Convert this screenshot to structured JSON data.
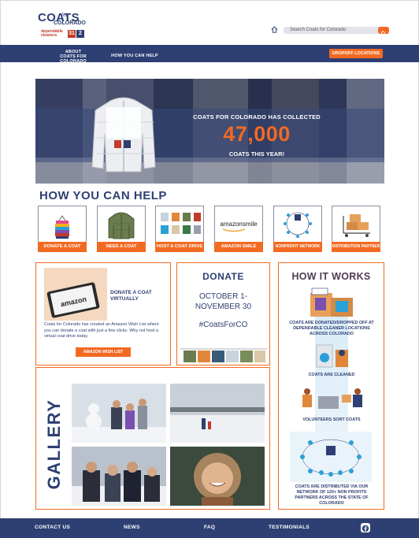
{
  "colors": {
    "navy": "#2e3f73",
    "orange": "#f26a22",
    "plum": "#4e3b52",
    "white": "#ffffff"
  },
  "header": {
    "logo": {
      "line1": "COATS",
      "for": "for",
      "line2": "COLORADO",
      "sponsor": "dependable cleaners",
      "badge1": "31",
      "badge2": "2",
      "icon": "coats-for-colorado-logo"
    },
    "home_icon": "home-icon",
    "search": {
      "placeholder": "Search Coats for Colorado",
      "icon": "search-icon"
    }
  },
  "nav": {
    "items": [
      {
        "label_top": "ABOUT",
        "label": "COATS FOR COLORADO"
      },
      {
        "label": "HOW YOU CAN HELP"
      }
    ],
    "cta": "DROPOFF LOCATIONS"
  },
  "hero": {
    "line1": "COATS FOR COLORADO HAS COLLECTED",
    "number": "47,000",
    "line2": "COATS THIS YEAR!"
  },
  "help": {
    "title": "HOW YOU CAN HELP",
    "cards": [
      {
        "label": "DONATE A COAT",
        "icon": "coat-stack-icon"
      },
      {
        "label": "NEED A COAT",
        "icon": "jacket-icon"
      },
      {
        "label": "HOST A COAT DRIVE",
        "icon": "coat-grid-icon"
      },
      {
        "label": "AMAZON SMILE",
        "icon": "amazon-smile-logo",
        "art_text": "amazonsmile"
      },
      {
        "label": "NONPROFIT NETWORK",
        "icon": "network-icon"
      },
      {
        "label": "DISTRIBUTION PARTNER",
        "icon": "boxes-cart-icon"
      }
    ]
  },
  "virtual": {
    "title": "DONATE A COAT VIRTUALLY",
    "phone_text": "amazon",
    "body": "Coats for Colorado has created an Amazon Wish List where you can donate a coat with just a few clicks. Why not host a virtual coat drive today.",
    "button": "AMAZON WISH LIST"
  },
  "donate": {
    "title": "DONATE",
    "dates_line1": "OCTOBER 1-",
    "dates_line2": "NOVEMBER 30",
    "hashtag": "#CoatsForCO"
  },
  "how": {
    "title": "HOW IT WORKS",
    "steps": [
      {
        "caption": "COATS ARE DONATED/DROPPED OFF AT DEPENDABLE CLEANER LOCATIONS ACROSS COLORADO"
      },
      {
        "caption": "COATS ARE CLEANED"
      },
      {
        "caption": "VOLUNTEERS SORT COATS"
      },
      {
        "caption": "COATS ARE DISTRIBUTED VIA OUR NETWORK OF 120+ NON PROFITS PARTNERS ACROSS THE STATE OF COLORADO"
      }
    ]
  },
  "gallery": {
    "title": "GALLERY",
    "photos": [
      "snowman-family-photo",
      "winter-walk-photo",
      "family-selfie-photo",
      "child-fur-hood-photo"
    ]
  },
  "footer": {
    "links": [
      "CONTACT US",
      "NEWS",
      "FAQ",
      "TESTIMONIALS"
    ],
    "social_icon": "facebook-icon"
  }
}
